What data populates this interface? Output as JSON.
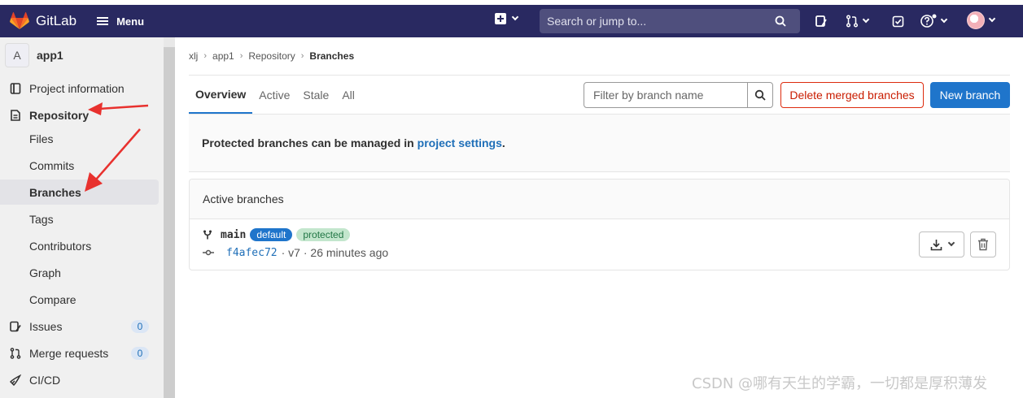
{
  "topbar": {
    "app_name": "GitLab",
    "menu_label": "Menu",
    "search_placeholder": "Search or jump to..."
  },
  "sidebar": {
    "project_initial": "A",
    "project_name": "app1",
    "items": [
      {
        "label": "Project information",
        "icon": "info-icon"
      },
      {
        "label": "Repository",
        "icon": "document-icon"
      },
      {
        "label": "Files"
      },
      {
        "label": "Commits"
      },
      {
        "label": "Branches",
        "active": true
      },
      {
        "label": "Tags"
      },
      {
        "label": "Contributors"
      },
      {
        "label": "Graph"
      },
      {
        "label": "Compare"
      },
      {
        "label": "Issues",
        "icon": "issues-icon",
        "count": "0"
      },
      {
        "label": "Merge requests",
        "icon": "merge-request-icon",
        "count": "0"
      },
      {
        "label": "CI/CD",
        "icon": "rocket-icon"
      }
    ]
  },
  "breadcrumb": [
    "xlj",
    "app1",
    "Repository",
    "Branches"
  ],
  "tabs": [
    "Overview",
    "Active",
    "Stale",
    "All"
  ],
  "filter_placeholder": "Filter by branch name",
  "buttons": {
    "delete_merged": "Delete merged branches",
    "new_branch": "New branch"
  },
  "info": {
    "text": "Protected branches can be managed in",
    "link": "project settings",
    "period": "."
  },
  "active_branches": {
    "title": "Active branches",
    "branch": {
      "name": "main",
      "badge_default": "default",
      "badge_protected": "protected",
      "commit_sha": "f4afec72",
      "commit_meta": "· v7 · 26 minutes ago"
    }
  },
  "watermark": "CSDN @哪有天生的学霸，一切都是厚积薄发",
  "colors": {
    "topbar": "#292961",
    "primary": "#1f75cb",
    "danger": "#dd2b0e",
    "annotation_arrow": "#e8312e"
  }
}
